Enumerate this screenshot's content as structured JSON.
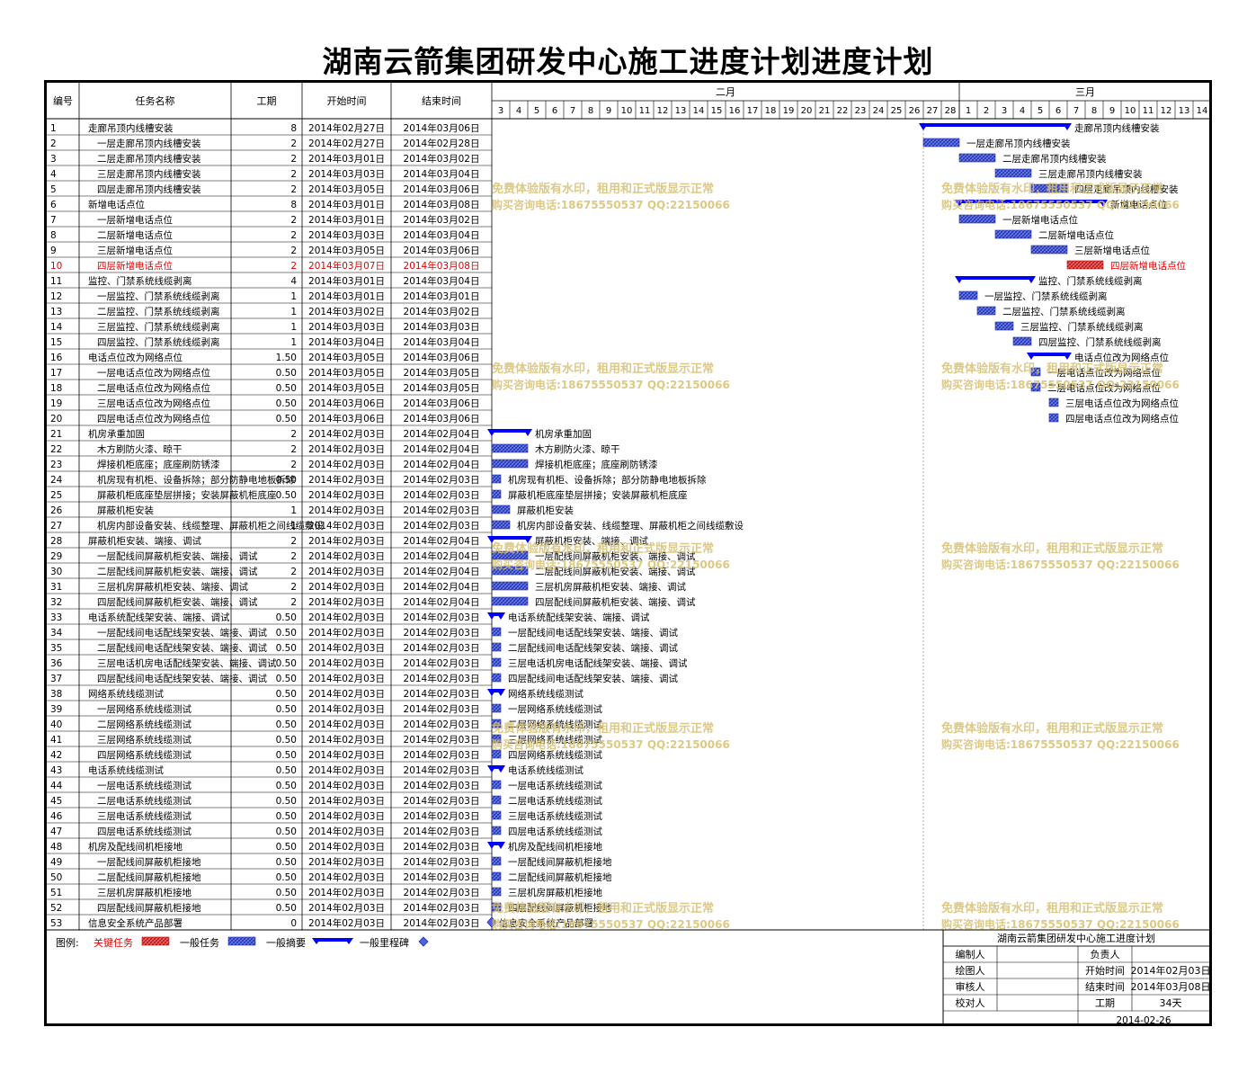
{
  "title": "湖南云箭集团研发中心施工进度计划进度计划",
  "chart_data": {
    "type": "gantt",
    "columns": [
      "编号",
      "任务名称",
      "工期",
      "开始时间",
      "结束时间"
    ],
    "months": [
      {
        "label": "二月",
        "days": [
          "3",
          "4",
          "5",
          "6",
          "7",
          "8",
          "9",
          "10",
          "11",
          "12",
          "13",
          "14",
          "15",
          "16",
          "17",
          "18",
          "19",
          "20",
          "21",
          "22",
          "23",
          "24",
          "25",
          "26",
          "27",
          "28"
        ]
      },
      {
        "label": "三月",
        "days": [
          "1",
          "2",
          "3",
          "4",
          "5",
          "6",
          "7",
          "8",
          "9",
          "10",
          "11",
          "12",
          "13",
          "14"
        ]
      }
    ],
    "tasks": [
      {
        "id": "1",
        "name": "走廊吊顶内线槽安装",
        "dur": "8",
        "start": "2014年02月27日",
        "end": "2014年03月06日",
        "type": "summary",
        "indent": 0
      },
      {
        "id": "2",
        "name": "一层走廊吊顶内线槽安装",
        "dur": "2",
        "start": "2014年02月27日",
        "end": "2014年02月28日",
        "type": "task",
        "indent": 1
      },
      {
        "id": "3",
        "name": "二层走廊吊顶内线槽安装",
        "dur": "2",
        "start": "2014年03月01日",
        "end": "2014年03月02日",
        "type": "task",
        "indent": 1
      },
      {
        "id": "4",
        "name": "三层走廊吊顶内线槽安装",
        "dur": "2",
        "start": "2014年03月03日",
        "end": "2014年03月04日",
        "type": "task",
        "indent": 1
      },
      {
        "id": "5",
        "name": "四层走廊吊顶内线槽安装",
        "dur": "2",
        "start": "2014年03月05日",
        "end": "2014年03月06日",
        "type": "task",
        "indent": 1
      },
      {
        "id": "6",
        "name": "新增电话点位",
        "dur": "8",
        "start": "2014年03月01日",
        "end": "2014年03月08日",
        "type": "summary",
        "indent": 0
      },
      {
        "id": "7",
        "name": "一层新增电话点位",
        "dur": "2",
        "start": "2014年03月01日",
        "end": "2014年03月02日",
        "type": "task",
        "indent": 1
      },
      {
        "id": "8",
        "name": "二层新增电话点位",
        "dur": "2",
        "start": "2014年03月03日",
        "end": "2014年03月04日",
        "type": "task",
        "indent": 1
      },
      {
        "id": "9",
        "name": "三层新增电话点位",
        "dur": "2",
        "start": "2014年03月05日",
        "end": "2014年03月06日",
        "type": "task",
        "indent": 1
      },
      {
        "id": "10",
        "name": "四层新增电话点位",
        "dur": "2",
        "start": "2014年03月07日",
        "end": "2014年03月08日",
        "type": "critical",
        "indent": 1
      },
      {
        "id": "11",
        "name": "监控、门禁系统线缆剥离",
        "dur": "4",
        "start": "2014年03月01日",
        "end": "2014年03月04日",
        "type": "summary",
        "indent": 0
      },
      {
        "id": "12",
        "name": "一层监控、门禁系统线缆剥离",
        "dur": "1",
        "start": "2014年03月01日",
        "end": "2014年03月01日",
        "type": "task",
        "indent": 1
      },
      {
        "id": "13",
        "name": "二层监控、门禁系统线缆剥离",
        "dur": "1",
        "start": "2014年03月02日",
        "end": "2014年03月02日",
        "type": "task",
        "indent": 1
      },
      {
        "id": "14",
        "name": "三层监控、门禁系统线缆剥离",
        "dur": "1",
        "start": "2014年03月03日",
        "end": "2014年03月03日",
        "type": "task",
        "indent": 1
      },
      {
        "id": "15",
        "name": "四层监控、门禁系统线缆剥离",
        "dur": "1",
        "start": "2014年03月04日",
        "end": "2014年03月04日",
        "type": "task",
        "indent": 1
      },
      {
        "id": "16",
        "name": "电话点位改为网络点位",
        "dur": "1.50",
        "start": "2014年03月05日",
        "end": "2014年03月06日",
        "type": "summary",
        "indent": 0
      },
      {
        "id": "17",
        "name": "一层电话点位改为网络点位",
        "dur": "0.50",
        "start": "2014年03月05日",
        "end": "2014年03月05日",
        "type": "task",
        "indent": 1
      },
      {
        "id": "18",
        "name": "二层电话点位改为网络点位",
        "dur": "0.50",
        "start": "2014年03月05日",
        "end": "2014年03月05日",
        "type": "task",
        "indent": 1
      },
      {
        "id": "19",
        "name": "三层电话点位改为网络点位",
        "dur": "0.50",
        "start": "2014年03月06日",
        "end": "2014年03月06日",
        "type": "task",
        "indent": 1
      },
      {
        "id": "20",
        "name": "四层电话点位改为网络点位",
        "dur": "0.50",
        "start": "2014年03月06日",
        "end": "2014年03月06日",
        "type": "task",
        "indent": 1
      },
      {
        "id": "21",
        "name": "机房承重加固",
        "dur": "2",
        "start": "2014年02月03日",
        "end": "2014年02月04日",
        "type": "summary",
        "indent": 0
      },
      {
        "id": "22",
        "name": "木方刷防火漆、晾干",
        "dur": "2",
        "start": "2014年02月03日",
        "end": "2014年02月04日",
        "type": "task",
        "indent": 1
      },
      {
        "id": "23",
        "name": "焊接机柜底座；底座刷防锈漆",
        "dur": "2",
        "start": "2014年02月03日",
        "end": "2014年02月04日",
        "type": "task",
        "indent": 1
      },
      {
        "id": "24",
        "name": "机房现有机柜、设备拆除；部分防静电地板拆除",
        "dur": "0.50",
        "start": "2014年02月03日",
        "end": "2014年02月03日",
        "type": "task",
        "indent": 1
      },
      {
        "id": "25",
        "name": "屏蔽机柜底座垫层拼接；安装屏蔽机柜底座",
        "dur": "0.50",
        "start": "2014年02月03日",
        "end": "2014年02月03日",
        "type": "task",
        "indent": 1
      },
      {
        "id": "26",
        "name": "屏蔽机柜安装",
        "dur": "1",
        "start": "2014年02月03日",
        "end": "2014年02月03日",
        "type": "task",
        "indent": 1
      },
      {
        "id": "27",
        "name": "机房内部设备安装、线缆整理、屏蔽机柜之间线缆敷设",
        "dur": "1",
        "start": "2014年02月03日",
        "end": "2014年02月03日",
        "type": "task",
        "indent": 1
      },
      {
        "id": "28",
        "name": "屏蔽机柜安装、端接、调试",
        "dur": "2",
        "start": "2014年02月03日",
        "end": "2014年02月04日",
        "type": "summary",
        "indent": 0
      },
      {
        "id": "29",
        "name": "一层配线间屏蔽机柜安装、端接、调试",
        "dur": "2",
        "start": "2014年02月03日",
        "end": "2014年02月04日",
        "type": "task",
        "indent": 1
      },
      {
        "id": "30",
        "name": "二层配线间屏蔽机柜安装、端接、调试",
        "dur": "2",
        "start": "2014年02月03日",
        "end": "2014年02月04日",
        "type": "task",
        "indent": 1
      },
      {
        "id": "31",
        "name": "三层机房屏蔽机柜安装、端接、调试",
        "dur": "2",
        "start": "2014年02月03日",
        "end": "2014年02月04日",
        "type": "task",
        "indent": 1
      },
      {
        "id": "32",
        "name": "四层配线间屏蔽机柜安装、端接、调试",
        "dur": "2",
        "start": "2014年02月03日",
        "end": "2014年02月04日",
        "type": "task",
        "indent": 1
      },
      {
        "id": "33",
        "name": "电话系统配线架安装、端接、调试",
        "dur": "0.50",
        "start": "2014年02月03日",
        "end": "2014年02月03日",
        "type": "summary",
        "indent": 0
      },
      {
        "id": "34",
        "name": "一层配线间电话配线架安装、端接、调试",
        "dur": "0.50",
        "start": "2014年02月03日",
        "end": "2014年02月03日",
        "type": "task",
        "indent": 1
      },
      {
        "id": "35",
        "name": "二层配线间电话配线架安装、端接、调试",
        "dur": "0.50",
        "start": "2014年02月03日",
        "end": "2014年02月03日",
        "type": "task",
        "indent": 1
      },
      {
        "id": "36",
        "name": "三层电话机房电话配线架安装、端接、调试",
        "dur": "0.50",
        "start": "2014年02月03日",
        "end": "2014年02月03日",
        "type": "task",
        "indent": 1
      },
      {
        "id": "37",
        "name": "四层配线间电话配线架安装、端接、调试",
        "dur": "0.50",
        "start": "2014年02月03日",
        "end": "2014年02月03日",
        "type": "task",
        "indent": 1
      },
      {
        "id": "38",
        "name": "网络系统线缆测试",
        "dur": "0.50",
        "start": "2014年02月03日",
        "end": "2014年02月03日",
        "type": "summary",
        "indent": 0
      },
      {
        "id": "39",
        "name": "一层网络系统线缆测试",
        "dur": "0.50",
        "start": "2014年02月03日",
        "end": "2014年02月03日",
        "type": "task",
        "indent": 1
      },
      {
        "id": "40",
        "name": "二层网络系统线缆测试",
        "dur": "0.50",
        "start": "2014年02月03日",
        "end": "2014年02月03日",
        "type": "task",
        "indent": 1
      },
      {
        "id": "41",
        "name": "三层网络系统线缆测试",
        "dur": "0.50",
        "start": "2014年02月03日",
        "end": "2014年02月03日",
        "type": "task",
        "indent": 1
      },
      {
        "id": "42",
        "name": "四层网络系统线缆测试",
        "dur": "0.50",
        "start": "2014年02月03日",
        "end": "2014年02月03日",
        "type": "task",
        "indent": 1
      },
      {
        "id": "43",
        "name": "电话系统线缆测试",
        "dur": "0.50",
        "start": "2014年02月03日",
        "end": "2014年02月03日",
        "type": "summary",
        "indent": 0
      },
      {
        "id": "44",
        "name": "一层电话系统线缆测试",
        "dur": "0.50",
        "start": "2014年02月03日",
        "end": "2014年02月03日",
        "type": "task",
        "indent": 1
      },
      {
        "id": "45",
        "name": "二层电话系统线缆测试",
        "dur": "0.50",
        "start": "2014年02月03日",
        "end": "2014年02月03日",
        "type": "task",
        "indent": 1
      },
      {
        "id": "46",
        "name": "三层电话系统线缆测试",
        "dur": "0.50",
        "start": "2014年02月03日",
        "end": "2014年02月03日",
        "type": "task",
        "indent": 1
      },
      {
        "id": "47",
        "name": "四层电话系统线缆测试",
        "dur": "0.50",
        "start": "2014年02月03日",
        "end": "2014年02月03日",
        "type": "task",
        "indent": 1
      },
      {
        "id": "48",
        "name": "机房及配线间机柜接地",
        "dur": "0.50",
        "start": "2014年02月03日",
        "end": "2014年02月03日",
        "type": "summary",
        "indent": 0
      },
      {
        "id": "49",
        "name": "一层配线间屏蔽机柜接地",
        "dur": "0.50",
        "start": "2014年02月03日",
        "end": "2014年02月03日",
        "type": "task",
        "indent": 1
      },
      {
        "id": "50",
        "name": "二层配线间屏蔽机柜接地",
        "dur": "0.50",
        "start": "2014年02月03日",
        "end": "2014年02月03日",
        "type": "task",
        "indent": 1
      },
      {
        "id": "51",
        "name": "三层机房屏蔽机柜接地",
        "dur": "0.50",
        "start": "2014年02月03日",
        "end": "2014年02月03日",
        "type": "task",
        "indent": 1
      },
      {
        "id": "52",
        "name": "四层配线间屏蔽机柜接地",
        "dur": "0.50",
        "start": "2014年02月03日",
        "end": "2014年02月03日",
        "type": "task",
        "indent": 1
      },
      {
        "id": "53",
        "name": "信息安全系统产品部署",
        "dur": "0",
        "start": "2014年02月03日",
        "end": "2014年02月03日",
        "type": "milestone",
        "indent": 0
      }
    ],
    "legend": {
      "label": "图例:",
      "items": [
        {
          "name": "关键任务",
          "type": "critical"
        },
        {
          "name": "一般任务",
          "type": "task"
        },
        {
          "name": "一般摘要",
          "type": "summary"
        },
        {
          "name": "一般里程碑",
          "type": "milestone"
        }
      ]
    },
    "watermark": {
      "line1": "免费体验版有水印，租用和正式版显示正常",
      "line2": "购买咨询电话:18675550537 QQ:22150066"
    },
    "colors": {
      "critical": "#e03030",
      "task": "#3a4fd0",
      "summary": "#0000ff",
      "critical_text": "#e00000",
      "watermark": "#d8c070"
    }
  },
  "info_box": {
    "title": "湖南云箭集团研发中心施工进度计划",
    "labels": {
      "compiler": "编制人",
      "responsible": "负责人",
      "drafter": "绘图人",
      "start": "开始时间",
      "reviewer": "审核人",
      "end": "结束时间",
      "checker": "校对人",
      "duration": "工期"
    },
    "values": {
      "start": "2014年02月03日",
      "end": "2014年03月08日",
      "duration": "34天"
    },
    "date": "2014-02-26"
  }
}
